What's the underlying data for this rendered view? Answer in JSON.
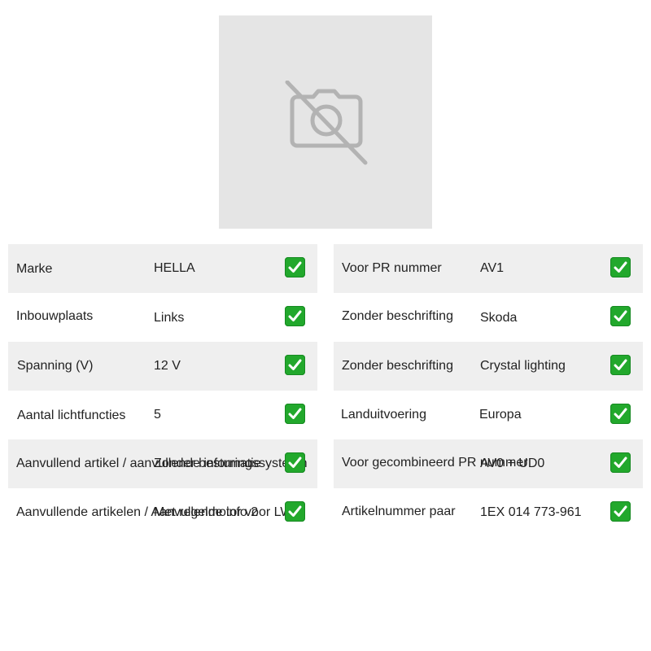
{
  "image_placeholder": {
    "icon": "no-camera-icon",
    "background_color": "#e5e5e5",
    "icon_color": "#b3b3b3"
  },
  "check_color": "#22a82c",
  "left_specs": [
    {
      "label": "Marke",
      "value": "HELLA",
      "checked": true
    },
    {
      "label": "Inbouwplaats",
      "value": "Links",
      "checked": true
    },
    {
      "label": "Spanning (V)",
      "value": "12 V",
      "checked": true
    },
    {
      "label": "Aantal lichtfuncties",
      "value": "5",
      "checked": true
    },
    {
      "label": "Aanvullend artikel / aanvullende informatie",
      "value": "Zonder besturingssysteem",
      "checked": true
    },
    {
      "label": "Aanvullende artikelen / Aanvullende info 2",
      "value": "Met regelmotor voor LWR",
      "checked": true
    }
  ],
  "right_specs": [
    {
      "label": "Voor PR nummer",
      "value": "AV1",
      "checked": true
    },
    {
      "label": "Zonder beschrifting",
      "value": "Skoda",
      "checked": true
    },
    {
      "label": "Zonder beschrifting",
      "value": "Crystal lighting",
      "checked": true
    },
    {
      "label": "Landuitvoering",
      "value": "Europa",
      "checked": true
    },
    {
      "label": "Voor gecombineerd PR nummer",
      "value": "AV0 + UD0",
      "checked": true
    },
    {
      "label": "Artikelnummer paar",
      "value": "1EX 014 773-961",
      "checked": true
    }
  ]
}
